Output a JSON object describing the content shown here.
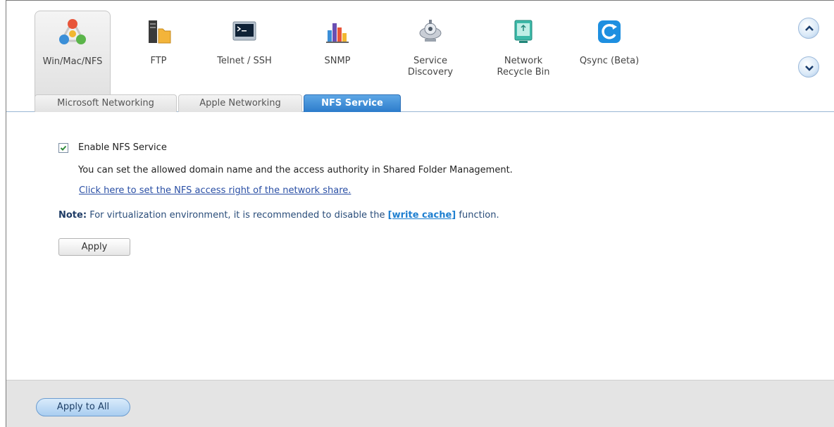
{
  "toolbar": {
    "items": [
      {
        "label": "Win/Mac/NFS",
        "icon": "win-mac-nfs-icon",
        "selected": true
      },
      {
        "label": "FTP",
        "icon": "ftp-icon"
      },
      {
        "label": "Telnet / SSH",
        "icon": "telnet-ssh-icon"
      },
      {
        "label": "SNMP",
        "icon": "snmp-icon"
      },
      {
        "label": "Service\nDiscovery",
        "icon": "service-discovery-icon"
      },
      {
        "label": "Network\nRecycle Bin",
        "icon": "recycle-bin-icon"
      },
      {
        "label": "Qsync (Beta)",
        "icon": "qsync-icon"
      }
    ],
    "scroll_up_icon": "chevron-up-icon",
    "scroll_down_icon": "chevron-down-icon"
  },
  "tabs": [
    {
      "label": "Microsoft Networking",
      "active": false
    },
    {
      "label": "Apple Networking",
      "active": false
    },
    {
      "label": "NFS Service",
      "active": true
    }
  ],
  "nfs": {
    "enable_label": "Enable NFS Service",
    "enabled": true,
    "description": "You can set the allowed domain name and the access authority in Shared Folder Management.",
    "link_text": "Click here to set the NFS access right of the network share.",
    "note_label": "Note:",
    "note_text": "For virtualization environment, it is recommended to disable the",
    "note_link": "[write cache]",
    "note_suffix": "function.",
    "apply_label": "Apply"
  },
  "footer": {
    "apply_all_label": "Apply to All"
  },
  "colors": {
    "active_tab": "#2c7ccb",
    "link": "#2a4fa5",
    "accent_link": "#1e7fd0"
  }
}
